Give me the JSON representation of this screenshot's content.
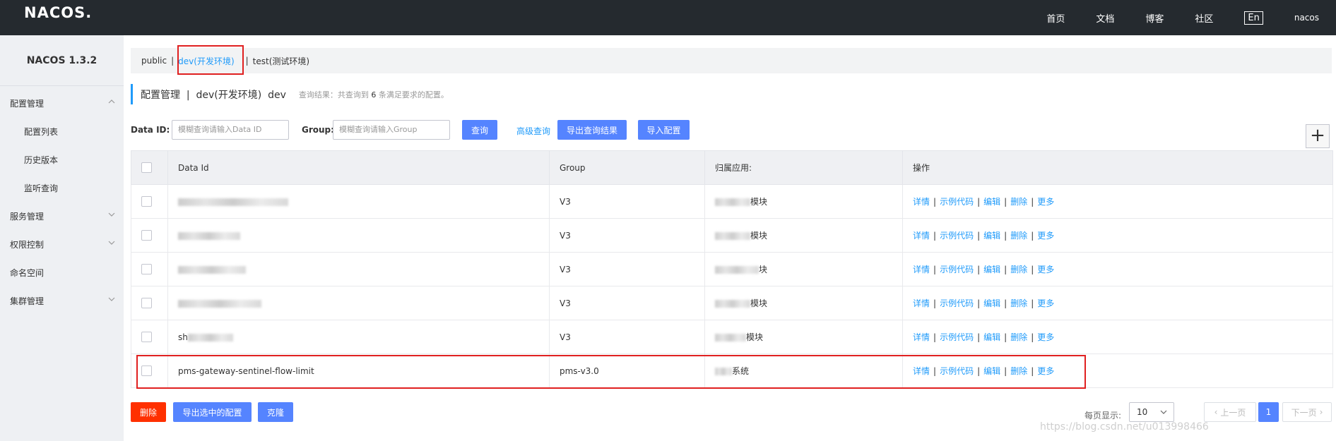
{
  "header": {
    "logo": "NACOS.",
    "nav": [
      "首页",
      "文档",
      "博客",
      "社区"
    ],
    "lang": "En",
    "user": "nacos"
  },
  "sidebar": {
    "title": "NACOS 1.3.2",
    "items": [
      {
        "label": "配置管理",
        "expanded": true
      },
      {
        "label": "配置列表"
      },
      {
        "label": "历史版本"
      },
      {
        "label": "监听查询"
      },
      {
        "label": "服务管理"
      },
      {
        "label": "权限控制"
      },
      {
        "label": "命名空间"
      },
      {
        "label": "集群管理"
      }
    ]
  },
  "namespaces": [
    "public",
    "dev(开发环境)",
    "test(测试环境)"
  ],
  "active_namespace": "dev(开发环境)",
  "page_header": {
    "title": "配置管理  |  dev(开发环境)  dev",
    "hint_prefix": "查询结果：共查询到",
    "hint_count": "6",
    "hint_suffix": "条满足要求的配置。"
  },
  "filter": {
    "dataid_label": "Data ID:",
    "dataid_placeholder": "模糊查询请输入Data ID",
    "group_label": "Group:",
    "group_placeholder": "模糊查询请输入Group",
    "query_button": "查询",
    "advanced_link": "高级查询",
    "export_button": "导出查询结果",
    "import_button": "导入配置",
    "add_symbol": "+"
  },
  "table": {
    "headers": [
      "Data Id",
      "Group",
      "归属应用:",
      "操作"
    ],
    "rows": [
      {
        "data_id": "",
        "group": "V3",
        "app": "模块"
      },
      {
        "data_id": "",
        "group": "V3",
        "app": "模块"
      },
      {
        "data_id": "",
        "group": "V3",
        "app": "块"
      },
      {
        "data_id": "",
        "group": "V3",
        "app": "模块"
      },
      {
        "data_id": "sh",
        "group": "V3",
        "app": "模块"
      },
      {
        "data_id": "pms-gateway-sentinel-flow-limit",
        "group": "pms-v3.0",
        "app": "系统"
      }
    ],
    "ops": [
      "详情",
      "示例代码",
      "编辑",
      "删除",
      "更多"
    ]
  },
  "footer": {
    "delete_button": "删除",
    "export_selected_button": "导出选中的配置",
    "clone_button": "克隆",
    "page_size_label": "每页显示:",
    "page_size": "10",
    "prev": "上一页",
    "current_page": "1",
    "next": "下一页"
  },
  "watermark": "https://blog.csdn.net/u013998466",
  "colors": {
    "header_bg": "#252a2f",
    "accent_blue": "#5584ff",
    "link_blue": "#209bfa",
    "danger_red": "#ff3000",
    "highlight_red": "#e02020"
  }
}
